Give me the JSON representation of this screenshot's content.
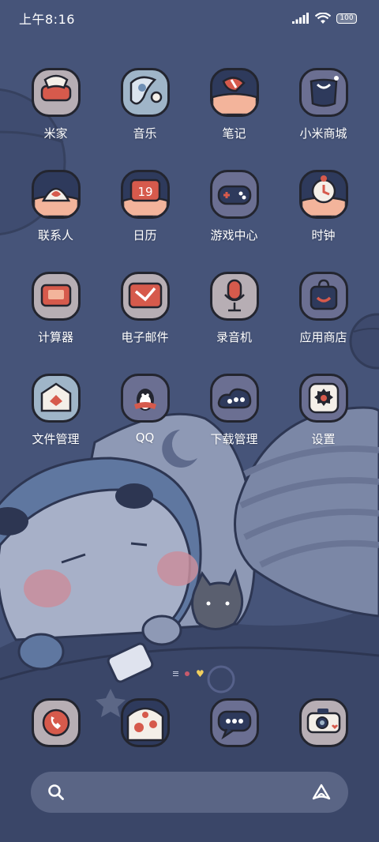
{
  "status_bar": {
    "time": "上午8:16",
    "battery": "100"
  },
  "apps": [
    {
      "label": "米家",
      "icon": "mijia-icon"
    },
    {
      "label": "音乐",
      "icon": "music-icon"
    },
    {
      "label": "笔记",
      "icon": "notes-icon"
    },
    {
      "label": "小米商城",
      "icon": "mi-store-icon"
    },
    {
      "label": "联系人",
      "icon": "contacts-icon"
    },
    {
      "label": "日历",
      "icon": "calendar-icon"
    },
    {
      "label": "游戏中心",
      "icon": "game-center-icon"
    },
    {
      "label": "时钟",
      "icon": "clock-icon"
    },
    {
      "label": "计算器",
      "icon": "calculator-icon"
    },
    {
      "label": "电子邮件",
      "icon": "email-icon"
    },
    {
      "label": "录音机",
      "icon": "recorder-icon"
    },
    {
      "label": "应用商店",
      "icon": "app-store-icon"
    },
    {
      "label": "文件管理",
      "icon": "file-manager-icon"
    },
    {
      "label": "QQ",
      "icon": "qq-icon"
    },
    {
      "label": "下载管理",
      "icon": "downloads-icon"
    },
    {
      "label": "设置",
      "icon": "settings-icon"
    }
  ],
  "calendar_day": "19",
  "dock": [
    {
      "icon": "phone-icon"
    },
    {
      "icon": "browser-icon"
    },
    {
      "icon": "messages-icon"
    },
    {
      "icon": "camera-icon"
    }
  ],
  "colors": {
    "background": "#465479",
    "icon_outline": "#23252f",
    "accent_red": "#d65a4c",
    "accent_pink": "#f3b49b",
    "icon_navy": "#2e3a5c"
  }
}
